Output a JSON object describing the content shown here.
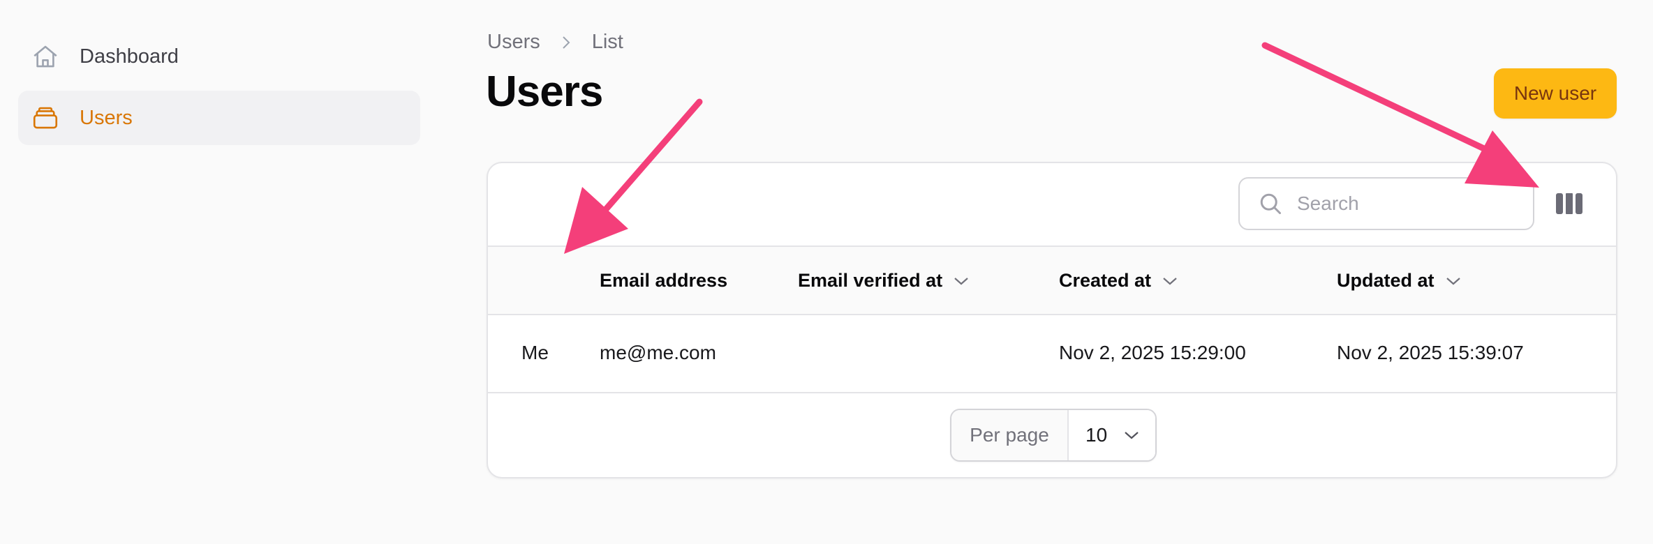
{
  "sidebar": {
    "items": [
      {
        "label": "Dashboard",
        "icon": "home-icon",
        "active": false
      },
      {
        "label": "Users",
        "icon": "stack-icon",
        "active": true
      }
    ]
  },
  "breadcrumb": {
    "items": [
      "Users",
      "List"
    ]
  },
  "header": {
    "title": "Users",
    "new_button_label": "New user"
  },
  "table": {
    "search_placeholder": "Search",
    "columns": [
      {
        "label": "",
        "sortable": false
      },
      {
        "label": "Email address",
        "sortable": false
      },
      {
        "label": "Email verified at",
        "sortable": true
      },
      {
        "label": "Created at",
        "sortable": true
      },
      {
        "label": "Updated at",
        "sortable": true
      }
    ],
    "rows": [
      {
        "name": "Me",
        "email": "me@me.com",
        "email_verified_at": "",
        "created_at": "Nov 2, 2025 15:29:00",
        "updated_at": "Nov 2, 2025 15:39:07"
      }
    ]
  },
  "pagination": {
    "per_page_label": "Per page",
    "per_page_value": "10"
  },
  "colors": {
    "accent": "#d97706",
    "button": "#fdb813",
    "annotation_arrow": "#f43f7a"
  }
}
